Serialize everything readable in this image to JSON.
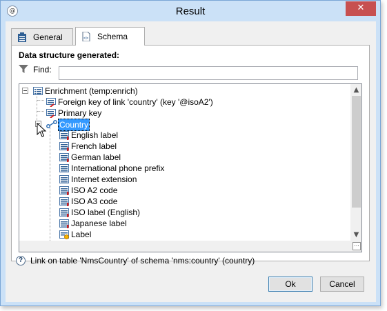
{
  "window": {
    "title": "Result",
    "close_label": "✕",
    "app_icon_glyph": "@"
  },
  "tabs": [
    {
      "label": "General",
      "icon": "clipboard-icon",
      "active": false
    },
    {
      "label": "Schema",
      "icon": "schema-file-icon",
      "active": true
    }
  ],
  "panel": {
    "heading": "Data structure generated:",
    "find_label": "Find:",
    "find_value": ""
  },
  "tree": {
    "root": {
      "label": "Enrichment (temp:enrich)",
      "icon": "list-icon",
      "expanded": true
    },
    "items": [
      {
        "label": "Foreign key of link 'country' (key '@isoA2')",
        "icon": "key-list-icon"
      },
      {
        "label": "Primary key",
        "icon": "key-list-icon"
      },
      {
        "label": "Country",
        "icon": "link-icon",
        "expanded": true,
        "selected": true
      }
    ],
    "country_children": [
      {
        "label": "English label",
        "icon": "field-icon"
      },
      {
        "label": "French label",
        "icon": "field-icon"
      },
      {
        "label": "German label",
        "icon": "field-icon"
      },
      {
        "label": "International phone prefix",
        "icon": "field-icon"
      },
      {
        "label": "Internet extension",
        "icon": "field-icon"
      },
      {
        "label": "ISO A2 code",
        "icon": "field-icon"
      },
      {
        "label": "ISO A3 code",
        "icon": "field-icon"
      },
      {
        "label": "ISO label (English)",
        "icon": "field-icon"
      },
      {
        "label": "Japanese label",
        "icon": "field-icon"
      },
      {
        "label": "Label",
        "icon": "computed-field-icon"
      }
    ]
  },
  "status": {
    "text": "Link on table 'NmsCountry' of schema 'nms:country' (country)",
    "icon": "help-icon"
  },
  "buttons": {
    "ok": "Ok",
    "cancel": "Cancel"
  },
  "colors": {
    "frame": "#cbe1f7",
    "close": "#c75050",
    "selection": "#3399ff"
  }
}
